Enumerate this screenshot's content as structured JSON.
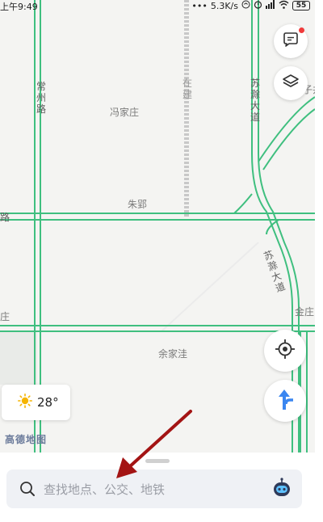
{
  "status_bar": {
    "time": "上午9:49",
    "network_speed": "5.3K/s",
    "battery_level": "55"
  },
  "map": {
    "labels": {
      "changzhou_road": "常州路",
      "fengjiazhuang": "冯家庄",
      "zaijian": "在建",
      "suchu_avenue_top": "苏滁大道",
      "suchu_avenue_lower": "苏滁大道",
      "zhuying": "朱郢",
      "left_road": "路",
      "yujiawa": "余家洼",
      "jinzhuang": "金庄",
      "left_edge": "庄",
      "right_edge_top": "子井"
    }
  },
  "weather": {
    "icon": "sun-icon",
    "temperature": "28°"
  },
  "logo": {
    "text": "高德地图"
  },
  "search": {
    "placeholder": "查找地点、公交、地铁"
  },
  "colors": {
    "road_green": "#3fbf7f",
    "road_gray": "#c8c8c8",
    "map_bg": "#f4f4f2",
    "arrow_red": "#a31414",
    "route_blue": "#3a86f0"
  }
}
